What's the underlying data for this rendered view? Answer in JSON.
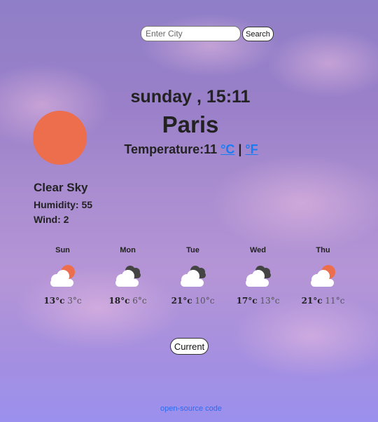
{
  "search": {
    "placeholder": "Enter City",
    "value": "",
    "button_label": "Search"
  },
  "weather": {
    "datetime": "sunday , 15:11",
    "city": "Paris",
    "temperature_label": "Temperature:",
    "temperature_value": "11",
    "unit_c": "°C",
    "unit_separator": " | ",
    "unit_f": "°F",
    "description": "Clear Sky",
    "humidity": "Humidity: 55",
    "wind": "Wind: 2",
    "icon": "sun-icon"
  },
  "forecast": [
    {
      "day": "Sun",
      "high": "13°c",
      "low": "3°c",
      "icon": "partly-sunny-icon"
    },
    {
      "day": "Mon",
      "high": "18°c",
      "low": "6°c",
      "icon": "cloudy-icon"
    },
    {
      "day": "Tue",
      "high": "21°c",
      "low": "10°c",
      "icon": "cloudy-icon"
    },
    {
      "day": "Wed",
      "high": "17°c",
      "low": "13°c",
      "icon": "cloudy-icon"
    },
    {
      "day": "Thu",
      "high": "21°c",
      "low": "11°c",
      "icon": "partly-sunny-icon"
    }
  ],
  "current_button_label": "Current",
  "footer_link": "open-source code",
  "colors": {
    "sun": "#ec6e4c",
    "link": "#1a7cf5",
    "footer_link": "#2a6cf5"
  }
}
